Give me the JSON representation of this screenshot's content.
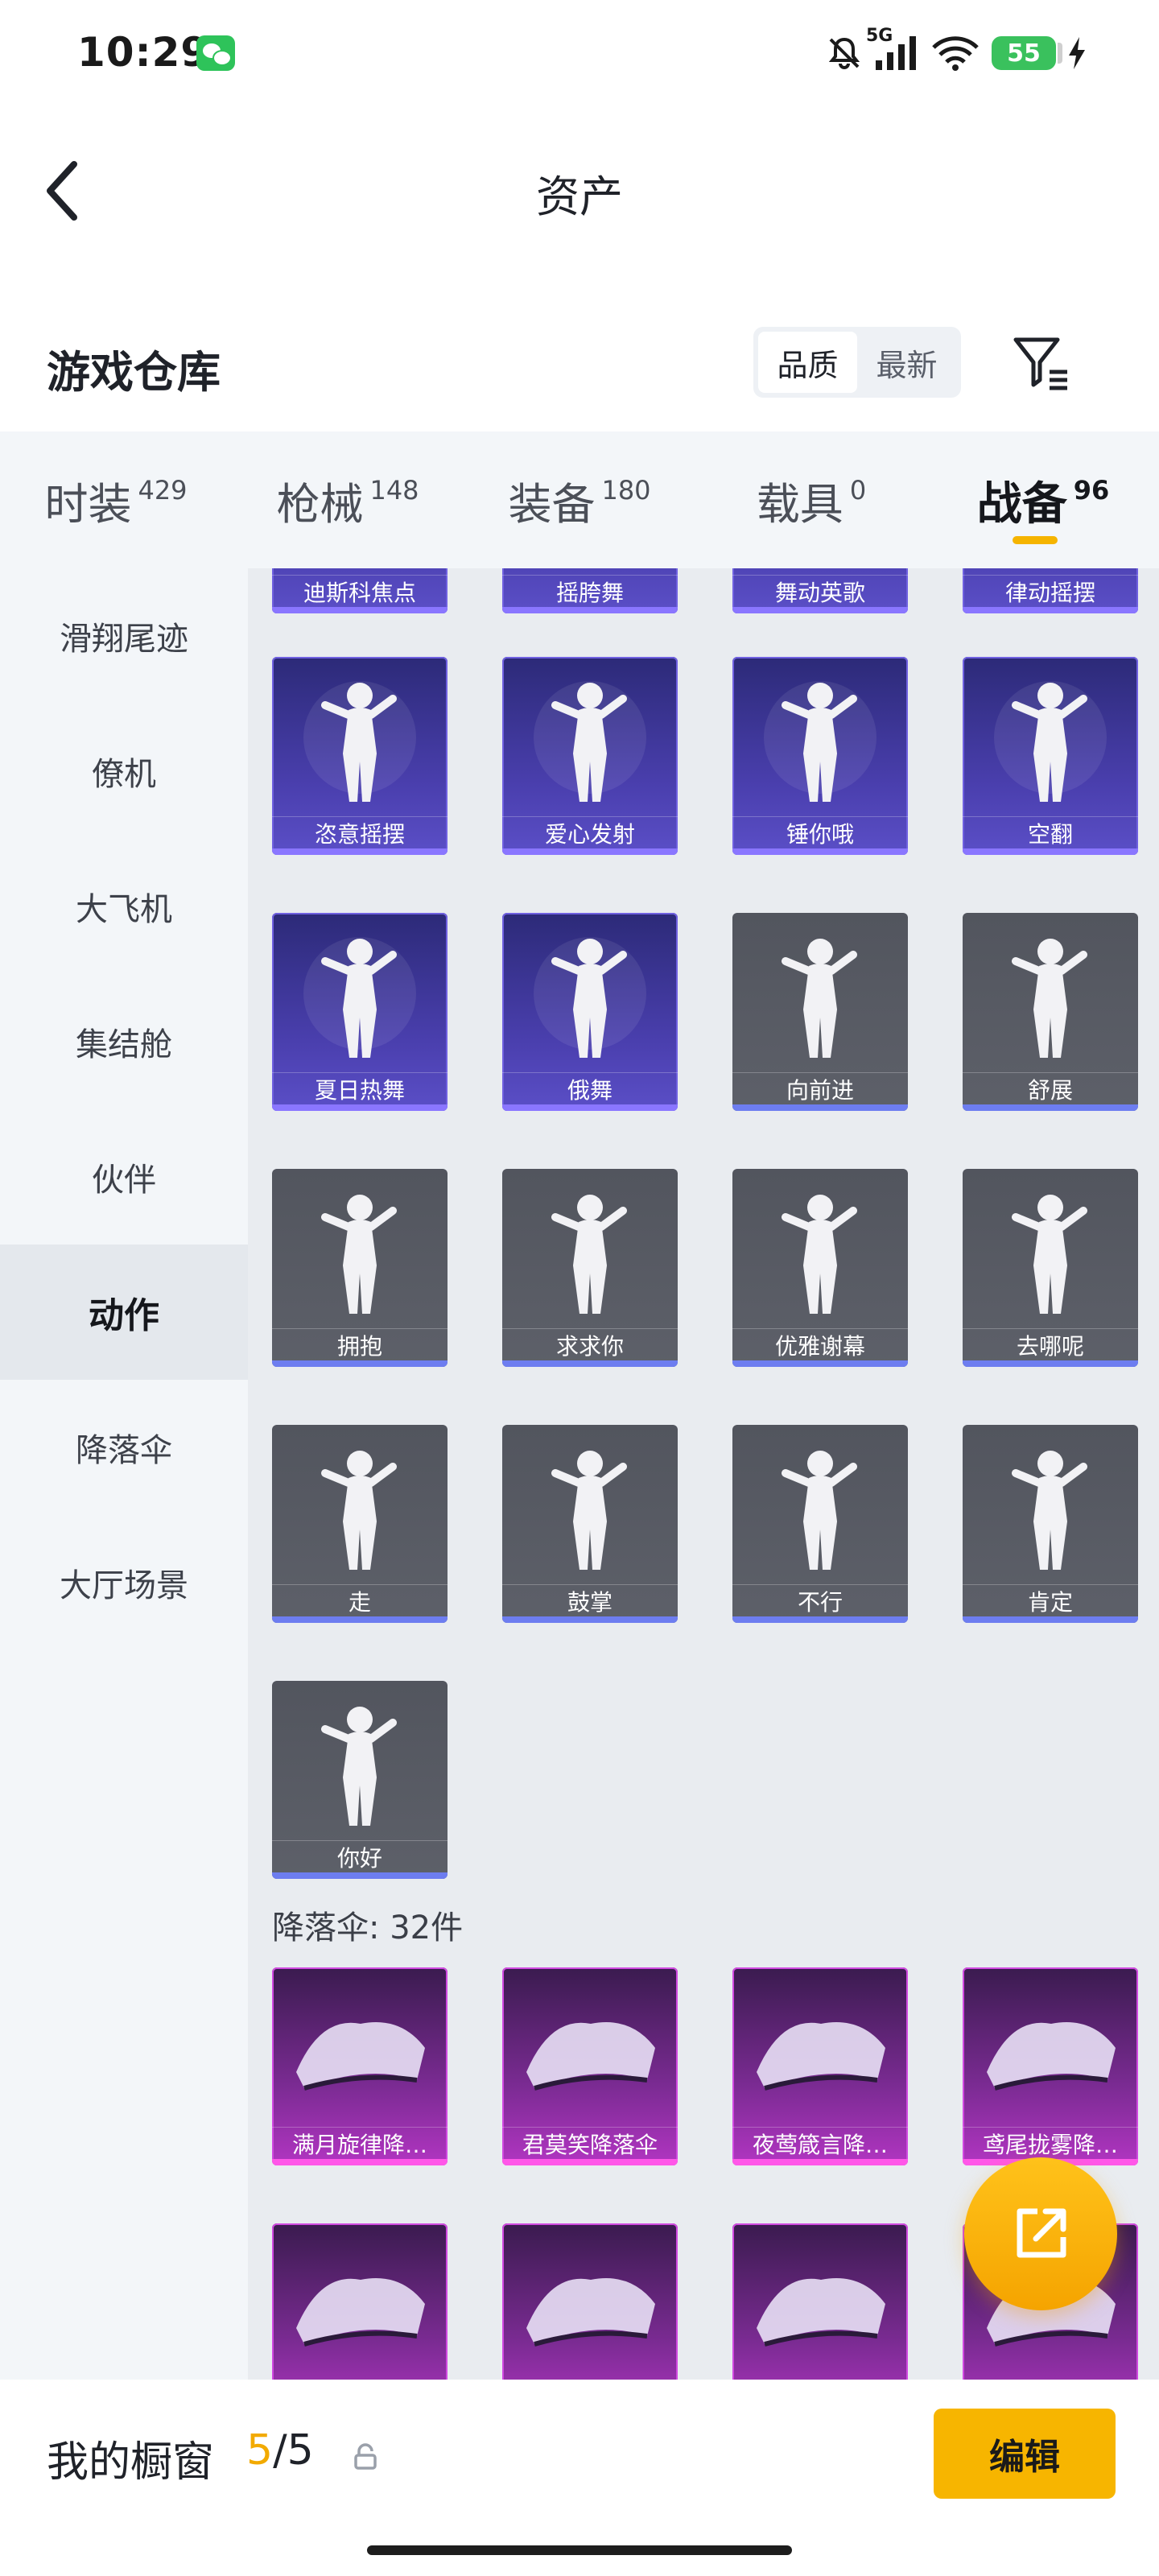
{
  "status_bar": {
    "time": "10:29",
    "network": "5G",
    "battery": "55",
    "app_icon": "wechat-icon"
  },
  "header": {
    "title": "资产",
    "back_icon": "chevron-left-icon"
  },
  "section": {
    "title": "游戏仓库",
    "sort_options": [
      "品质",
      "最新"
    ],
    "active_sort": "品质",
    "filter_icon": "filter-icon"
  },
  "tabs": [
    {
      "label": "时装",
      "count": "429"
    },
    {
      "label": "枪械",
      "count": "148"
    },
    {
      "label": "装备",
      "count": "180"
    },
    {
      "label": "载具",
      "count": "0"
    },
    {
      "label": "战备",
      "count": "96",
      "active": true
    }
  ],
  "sidebar": {
    "items": [
      {
        "label": "滑翔尾迹"
      },
      {
        "label": "僚机"
      },
      {
        "label": "大飞机"
      },
      {
        "label": "集结舱"
      },
      {
        "label": "伙伴"
      },
      {
        "label": "动作",
        "active": true
      },
      {
        "label": "降落伞"
      },
      {
        "label": "大厅场景"
      }
    ]
  },
  "actions_partial_row": [
    {
      "label": "迪斯科焦点"
    },
    {
      "label": "摇胯舞"
    },
    {
      "label": "舞动英歌"
    },
    {
      "label": "律动摇摆"
    }
  ],
  "actions": [
    {
      "label": "恣意摇摆",
      "style": "purple"
    },
    {
      "label": "爱心发射",
      "style": "purple"
    },
    {
      "label": "锤你哦",
      "style": "purple"
    },
    {
      "label": "空翻",
      "style": "purple"
    },
    {
      "label": "夏日热舞",
      "style": "purple"
    },
    {
      "label": "俄舞",
      "style": "purple"
    },
    {
      "label": "向前进",
      "style": "gray"
    },
    {
      "label": "舒展",
      "style": "gray"
    },
    {
      "label": "拥抱",
      "style": "gray"
    },
    {
      "label": "求求你",
      "style": "gray"
    },
    {
      "label": "优雅谢幕",
      "style": "gray"
    },
    {
      "label": "去哪呢",
      "style": "gray"
    },
    {
      "label": "走",
      "style": "gray"
    },
    {
      "label": "鼓掌",
      "style": "gray"
    },
    {
      "label": "不行",
      "style": "gray"
    },
    {
      "label": "肯定",
      "style": "gray"
    },
    {
      "label": "你好",
      "style": "gray"
    }
  ],
  "parachute_group": {
    "heading": "降落伞: 32件"
  },
  "parachutes": [
    {
      "label": "满月旋律降…",
      "style": "pink"
    },
    {
      "label": "君莫笑降落伞",
      "style": "pink"
    },
    {
      "label": "夜莺箴言降…",
      "style": "pink"
    },
    {
      "label": "鸢尾拢雾降…",
      "style": "pink"
    },
    {
      "label": "",
      "style": "pink"
    },
    {
      "label": "",
      "style": "pink"
    },
    {
      "label": "",
      "style": "pink"
    },
    {
      "label": "",
      "style": "pink"
    }
  ],
  "bottom_bar": {
    "title": "我的橱窗",
    "count_current": "5",
    "count_total": "/5",
    "edit_label": "编辑"
  },
  "colors": {
    "accent": "#F7B500",
    "purple_card": "#4A3FAE",
    "gray_card": "#5D6069",
    "pink_card": "#7B2B93"
  }
}
